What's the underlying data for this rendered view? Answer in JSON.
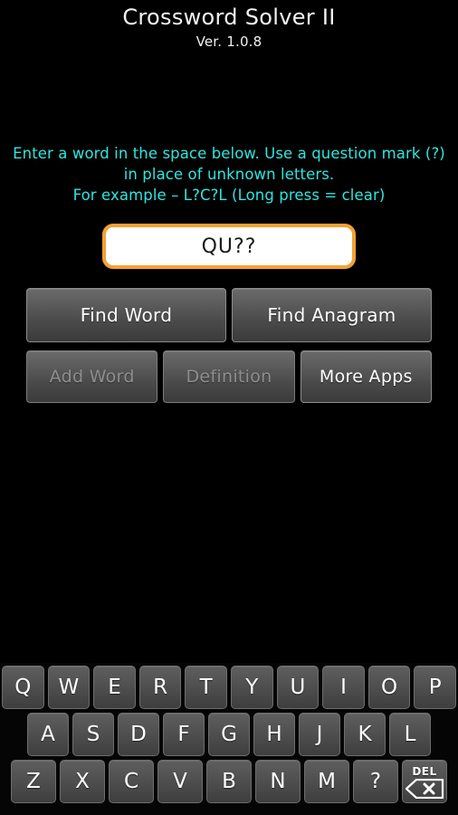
{
  "header": {
    "title": "Crossword Solver II",
    "version": "Ver. 1.0.8"
  },
  "instructions": {
    "line1": "Enter a word in the space below. Use a question mark (?) in place of unknown letters.",
    "line2": "For example – L?C?L (Long press = clear)"
  },
  "input": {
    "value": "QU??",
    "placeholder": ""
  },
  "buttons": {
    "find_word": "Find Word",
    "find_anagram": "Find Anagram",
    "add_word": "Add Word",
    "definition": "Definition",
    "more_apps": "More Apps"
  },
  "keyboard": {
    "row1": [
      "Q",
      "W",
      "E",
      "R",
      "T",
      "Y",
      "U",
      "I",
      "O",
      "P"
    ],
    "row2": [
      "A",
      "S",
      "D",
      "F",
      "G",
      "H",
      "J",
      "K",
      "L"
    ],
    "row3": [
      "Z",
      "X",
      "C",
      "V",
      "B",
      "N",
      "M",
      "?"
    ],
    "delete_label": "DEL"
  },
  "colors": {
    "background": "#000000",
    "instruction_text": "#2ee6e0",
    "input_border": "#f5a032",
    "input_background": "#ffffff",
    "button_text": "#ffffff",
    "button_text_disabled": "#8e8e8e"
  }
}
